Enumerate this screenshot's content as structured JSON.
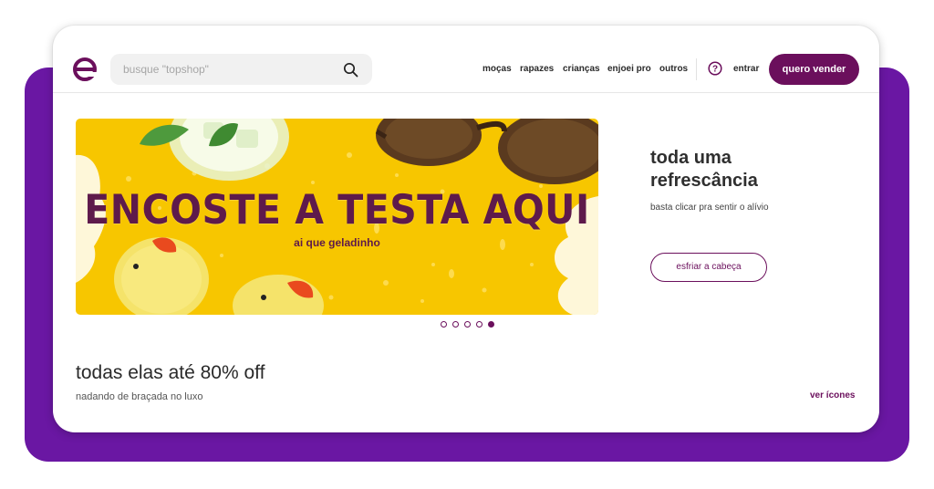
{
  "colors": {
    "brand": "#6b0f5c",
    "backdrop": "#6a17a3",
    "banner_yellow": "#f7c600",
    "banner_text": "#5e1a4b"
  },
  "header": {
    "logo_icon": "enjoei-e-logo-icon",
    "search": {
      "placeholder": "busque \"topshop\"",
      "value": "",
      "icon": "search-icon"
    },
    "nav": [
      "moças",
      "rapazes",
      "crianças",
      "enjoei pro",
      "outros"
    ],
    "help_icon": "question-circle-icon",
    "login_label": "entrar",
    "sell_label": "quero vender"
  },
  "banner": {
    "headline": "ENCOSTE A TESTA AQUI",
    "subline": "ai que geladinho"
  },
  "promo": {
    "title_lines": [
      "toda uma",
      "refrescância"
    ],
    "subtitle": "basta clicar pra sentir o alívio",
    "cta": "esfriar a cabeça"
  },
  "carousel": {
    "slides": 5,
    "active": 5
  },
  "section": {
    "title": "todas elas até 80% off",
    "subtitle": "nadando de braçada no luxo",
    "link": "ver ícones"
  }
}
